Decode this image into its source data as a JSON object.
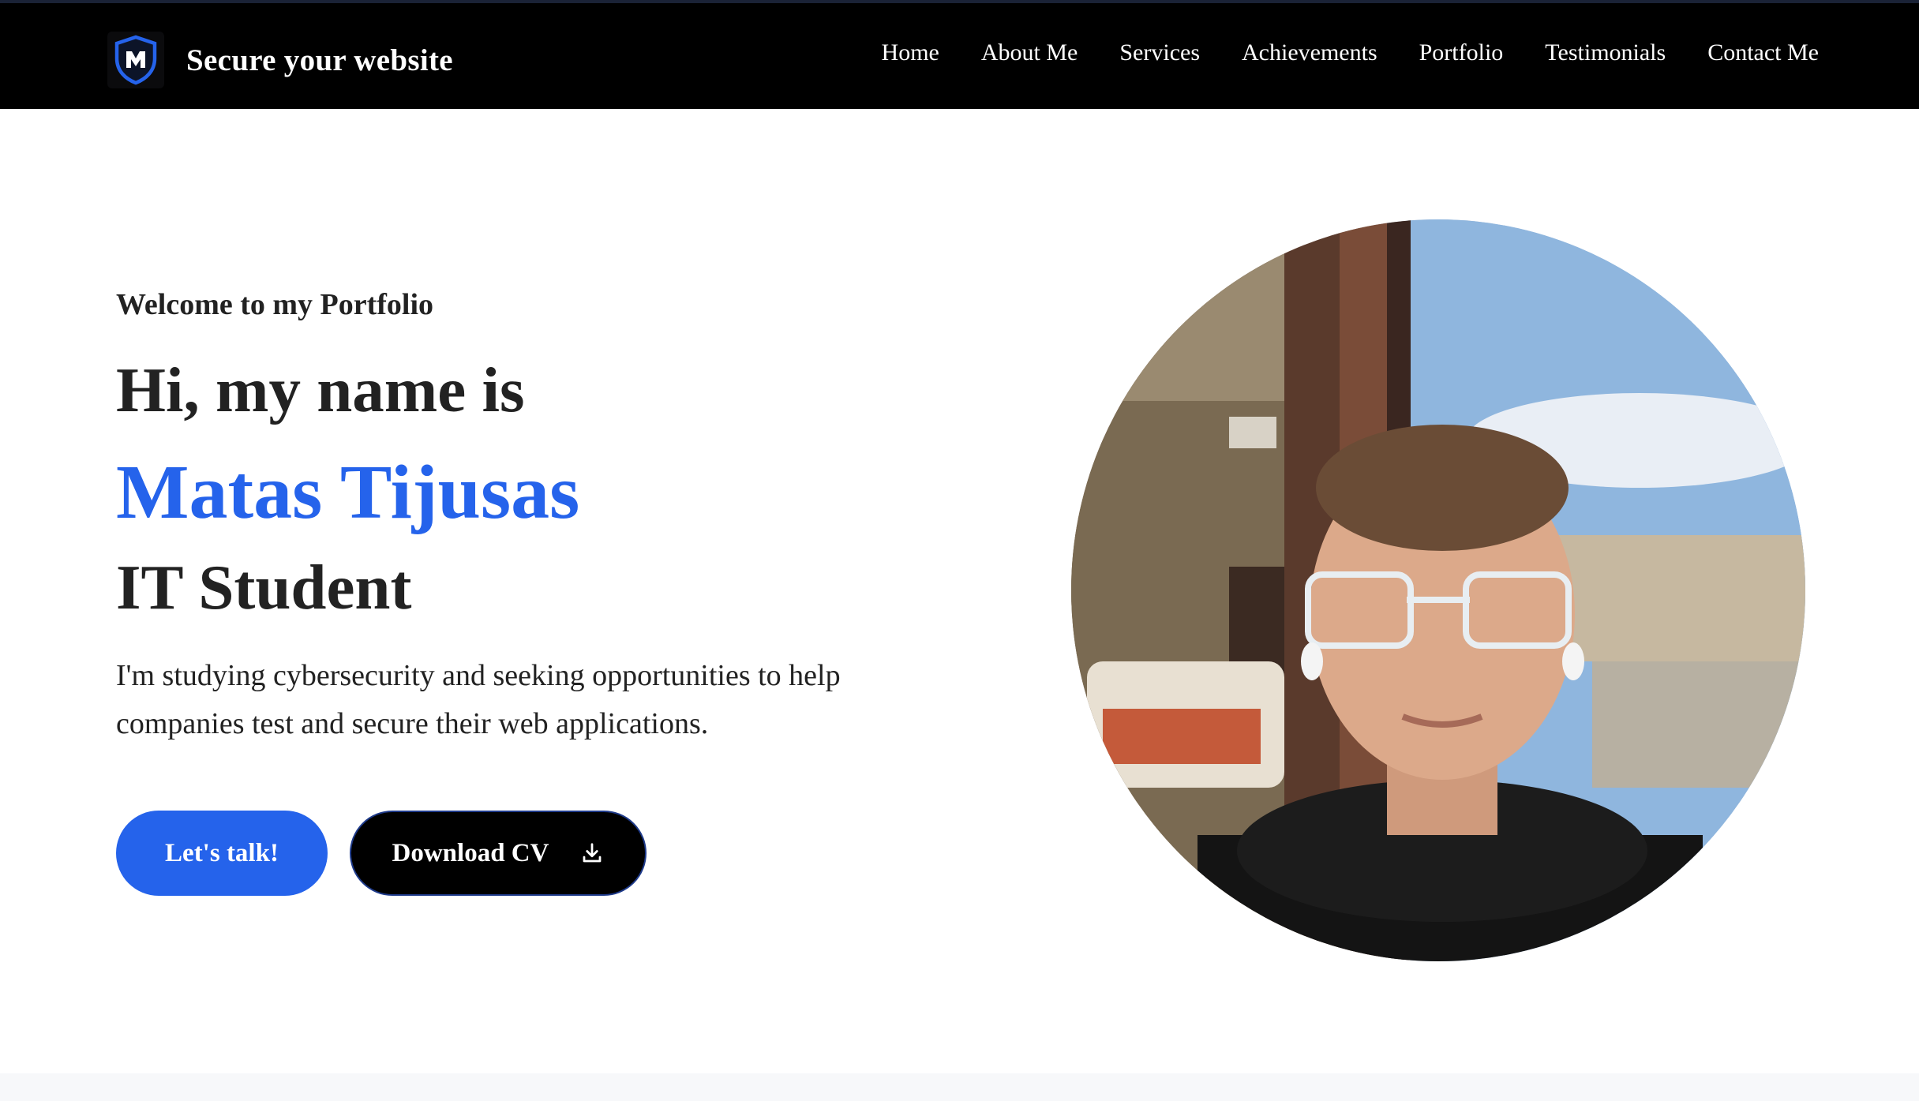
{
  "brand": {
    "title": "Secure your website",
    "logo_icon": "shield-m-logo-icon"
  },
  "nav": {
    "items": [
      "Home",
      "About Me",
      "Services",
      "Achievements",
      "Portfolio",
      "Testimonials",
      "Contact Me"
    ]
  },
  "hero": {
    "welcome": "Welcome to my Portfolio",
    "greeting": "Hi, my name is",
    "name": "Matas Tijusas",
    "role": "IT Student",
    "description": "I'm studying cybersecurity and seeking opportunities to help companies test and secure their web applications.",
    "cta_primary": "Let's talk!",
    "cta_secondary": "Download CV",
    "download_icon": "download-icon"
  },
  "colors": {
    "accent": "#2563eb",
    "navbar_bg": "#000000",
    "text": "#222222"
  }
}
